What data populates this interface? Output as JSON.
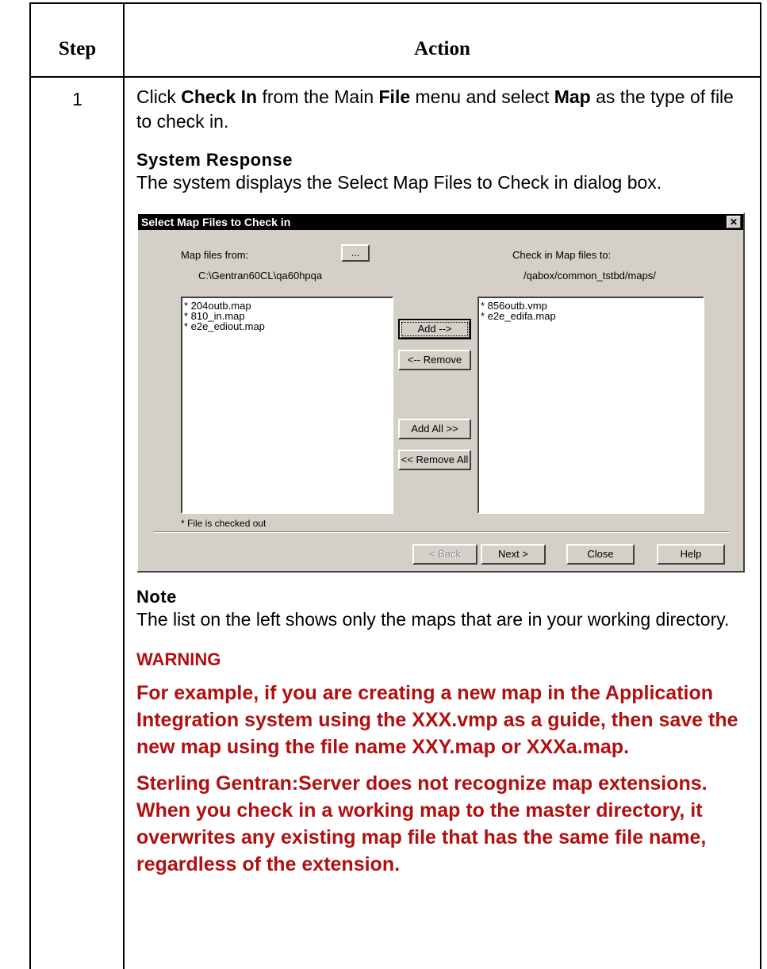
{
  "table": {
    "header_step": "Step",
    "header_action": "Action",
    "step_number": "1"
  },
  "instruction": {
    "part1": "Click ",
    "bold1": "Check In",
    "part2": " from the Main ",
    "bold2": "File",
    "part3": " menu and select ",
    "bold3": "Map",
    "part4": " as the type of file to check in."
  },
  "system_response": {
    "heading": "System Response",
    "text": "The system displays the Select Map Files to Check in dialog box."
  },
  "dialog": {
    "title": "Select Map Files to Check in",
    "close_glyph": "✕",
    "map_files_from_label": "Map files from:",
    "browse_button": "...",
    "source_path": "C:\\Gentran60CL\\qa60hpqa",
    "check_in_to_label": "Check in Map files to:",
    "dest_path": "/qabox/common_tstbd/maps/",
    "left_list": [
      "* 204outb.map",
      "* 810_in.map",
      "* e2e_ediout.map"
    ],
    "right_list": [
      "* 856outb.vmp",
      "* e2e_edifa.map"
    ],
    "add_button": "Add -->",
    "remove_button": "<-- Remove",
    "add_all_button": "Add All  >>",
    "remove_all_button": "<< Remove All",
    "footnote": "* File is checked out",
    "back_button": "< Back",
    "next_button": "Next >",
    "close_button": "Close",
    "help_button": "Help"
  },
  "note": {
    "heading": "Note",
    "text": "The list on the left shows only the maps that are in your working directory."
  },
  "warning": {
    "heading": "WARNING",
    "paragraph1": "For example, if you are creating a new map in the Application Integration system using the XXX.vmp as a guide, then save the new map using the file name XXY.map or XXXa.map.",
    "paragraph2": "Sterling Gentran:Server does not recognize map extensions. When you check in a working map to the master directory, it overwrites any existing map file that has the same file name, regardless of the extension."
  },
  "colors": {
    "warning_red": "#b01010",
    "dialog_face": "#d4d0c8",
    "title_bar": "#000000"
  }
}
